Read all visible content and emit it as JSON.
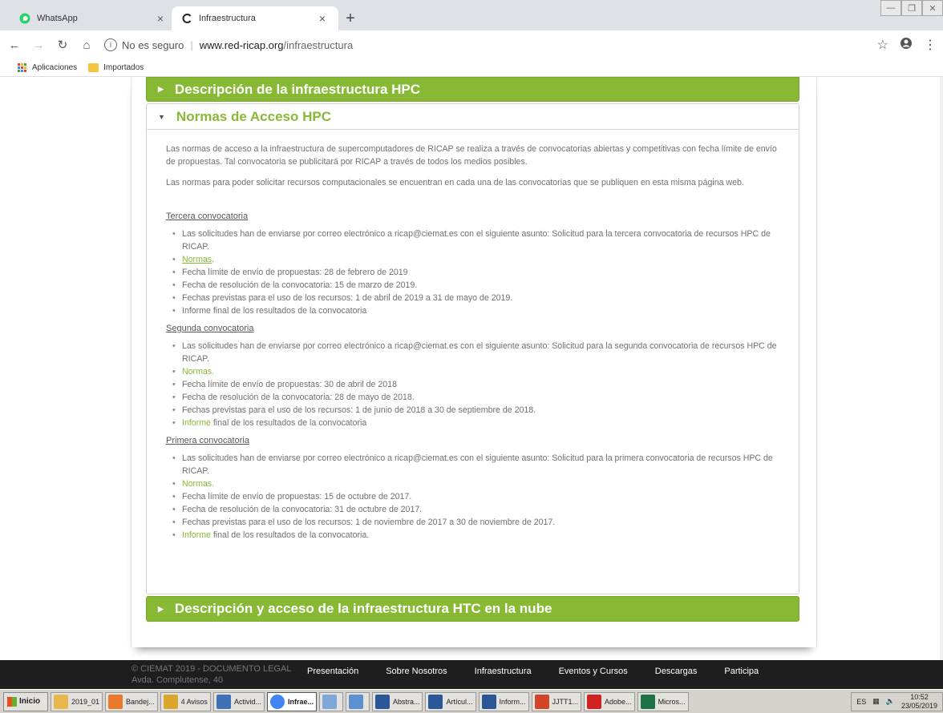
{
  "browser": {
    "tabs": [
      {
        "label": "WhatsApp",
        "active": false,
        "icon": "whatsapp-icon"
      },
      {
        "label": "Infraestructura",
        "active": true,
        "icon": "loading-icon"
      }
    ],
    "new_tab": "+",
    "security": "No es seguro",
    "url_host": "www.red-ricap.org",
    "url_path": "/infraestructura",
    "bookmarks": [
      {
        "label": "Aplicaciones",
        "icon": "apps-grid-icon"
      },
      {
        "label": "Importados",
        "icon": "folder-icon"
      }
    ]
  },
  "page": {
    "accordion": {
      "section1": "Descripción de la infraestructura HPC",
      "section2": "Normas de Acceso HPC",
      "section3": "Descripción y acceso de la infraestructura HTC en la nube"
    },
    "intro1": "Las normas de acceso a la infraestructura de supercomputadores de RICAP se realiza a través de convocatorias abiertas y competitivas con fecha límite de envío de propuestas. Tal convocatoria se publicitará por RICAP a través de todos los medios posibles.",
    "intro2": "Las normas para poder solicitar recursos computacionales se encuentran en cada una de las convocatorias que se publiquen en esta misma página web.",
    "tercera": {
      "title": "Tercera convocatoria",
      "item1": "Las solicitudes han de enviarse por correo electrónico a ricap@ciemat.es con el siguiente asunto: Solicitud para la tercera convocatoria de recursos HPC de RICAP.",
      "normas": "Normas",
      "normas_suffix": ".",
      "item3": "Fecha límite de envío de propuestas: 28 de febrero de 2019",
      "item4": "Fecha de resolución de la convocatoria: 15 de marzo de 2019.",
      "item5": "Fechas previstas para el uso de los recursos: 1 de abril de 2019 a 31 de mayo de 2019.",
      "item6": "Informe final de los resultados de la convocatoria"
    },
    "segunda": {
      "title": "Segunda convocatoria",
      "item1": "Las solicitudes han de enviarse por correo electrónico a ricap@ciemat.es con el siguiente asunto: Solicitud para la segunda convocatoria de recursos HPC de RICAP.",
      "normas": "Normas.",
      "item3": "Fecha límite de envío de propuestas: 30 de abril de 2018",
      "item4": "Fecha de resolución de la convocatoria: 28 de mayo de 2018.",
      "item5": "Fechas previstas para el uso de los recursos: 1 de junio de 2018 a 30 de septiembre de 2018.",
      "informe_link": "Informe",
      "informe_rest": " final de los resultados de la convocatoria"
    },
    "primera": {
      "title": "Primera convocatoria",
      "item1": "Las solicitudes han de enviarse por correo electrónico a ricap@ciemat.es con el siguiente asunto: Solicitud para la primera convocatoria de recursos HPC de RICAP.",
      "normas": "Normas.",
      "item3": "Fecha límite de envío de propuestas: 15 de octubre de 2017.",
      "item4": "Fecha de resolución de la convocatoria: 31 de octubre de 2017.",
      "item5": "Fechas previstas para el uso de los recursos: 1 de noviembre de 2017 a 30 de noviembre de 2017.",
      "informe_link": "Informe",
      "informe_rest": " final de los resultados de la convocatoria."
    }
  },
  "footer": {
    "copyright": "© CIEMAT 2019 - DOCUMENTO LEGAL",
    "address": "Avda. Complutense, 40",
    "nav": [
      "Presentación",
      "Sobre Nosotros",
      "Infraestructura",
      "Eventos y Cursos",
      "Descargas",
      "Participa"
    ]
  },
  "taskbar": {
    "start": "Inicio",
    "items": [
      {
        "label": "2019_01",
        "color": "#e8b84a"
      },
      {
        "label": "Bandej...",
        "color": "#e8792b"
      },
      {
        "label": "4 Avisos",
        "color": "#d9a52a"
      },
      {
        "label": "Activid...",
        "color": "#3f6fb5"
      },
      {
        "label": "Infrae...",
        "color": "#4285f4"
      },
      {
        "label": "",
        "color": "#7fa8d8"
      },
      {
        "label": "",
        "color": "#5b8fd0"
      },
      {
        "label": "Abstra...",
        "color": "#2b5797"
      },
      {
        "label": "Artícul...",
        "color": "#2b5797"
      },
      {
        "label": "Inform...",
        "color": "#2b5797"
      },
      {
        "label": "JJTT1...",
        "color": "#d04525"
      },
      {
        "label": "Adobe...",
        "color": "#d1221f"
      },
      {
        "label": "Micros...",
        "color": "#207245"
      }
    ],
    "lang": "ES",
    "time": "10:52",
    "date": "23/05/2019"
  },
  "colors": {
    "accent_green": "#88b934",
    "footer_bg": "#1e1e1e"
  }
}
